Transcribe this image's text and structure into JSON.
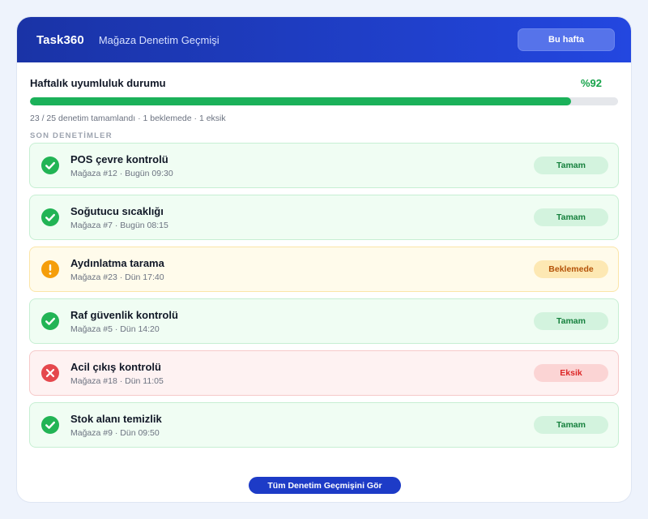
{
  "header": {
    "brand": "Task360",
    "subtitle": "Mağaza Denetim Geçmişi",
    "week_button": "Bu hafta"
  },
  "summary": {
    "title": "Haftalık uyumluluk durumu",
    "percent_label": "%92",
    "progress_fraction": 0.92,
    "stats": "23 / 25 denetim tamamlandı · 1 beklemede · 1 eksik"
  },
  "section_label": "SON DENETİMLER",
  "colors": {
    "header_start": "#1a33a6",
    "header_end": "#2347e0",
    "ok": "#22b455",
    "pending": "#f59e0b",
    "missing": "#e5484d"
  },
  "audits": [
    {
      "title": "POS çevre kontrolü",
      "meta": "Mağaza #12 · Bugün 09:30",
      "status": "ok",
      "badge": "Tamam",
      "icon": "check-circle-icon"
    },
    {
      "title": "Soğutucu sıcaklığı",
      "meta": "Mağaza #7 · Bugün 08:15",
      "status": "ok",
      "badge": "Tamam",
      "icon": "check-circle-icon"
    },
    {
      "title": "Aydınlatma tarama",
      "meta": "Mağaza #23 · Dün 17:40",
      "status": "pending",
      "badge": "Beklemede",
      "icon": "warning-circle-icon"
    },
    {
      "title": "Raf güvenlik kontrolü",
      "meta": "Mağaza #5 · Dün 14:20",
      "status": "ok",
      "badge": "Tamam",
      "icon": "check-circle-icon"
    },
    {
      "title": "Acil çıkış kontrolü",
      "meta": "Mağaza #18 · Dün 11:05",
      "status": "missing",
      "badge": "Eksik",
      "icon": "x-circle-icon"
    },
    {
      "title": "Stok alanı temizlik",
      "meta": "Mağaza #9 · Dün 09:50",
      "status": "ok",
      "badge": "Tamam",
      "icon": "check-circle-icon"
    }
  ],
  "footer_button": "Tüm Denetim Geçmişini Gör"
}
